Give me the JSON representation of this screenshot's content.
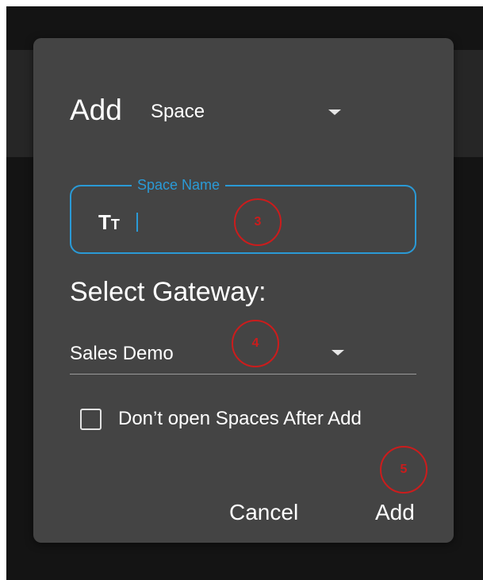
{
  "dialog": {
    "title_prefix": "Add",
    "type_select": {
      "value": "Space"
    },
    "space_name": {
      "label": "Space Name",
      "icon_big": "T",
      "icon_small": "T",
      "icon": "text-format-icon",
      "value": ""
    },
    "gateway": {
      "heading": "Select Gateway:",
      "value": "Sales Demo"
    },
    "checkbox": {
      "label": "Don’t open Spaces After Add",
      "checked": false
    },
    "buttons": {
      "cancel": "Cancel",
      "add": "Add"
    }
  },
  "annotations": [
    {
      "label": "3",
      "target": "space-name-field"
    },
    {
      "label": "4",
      "target": "gateway-select"
    },
    {
      "label": "5",
      "target": "add-button"
    }
  ],
  "colors": {
    "accent": "#2a9ad6",
    "dialog_background": "#444444",
    "annotation": "#cc1c1c"
  }
}
